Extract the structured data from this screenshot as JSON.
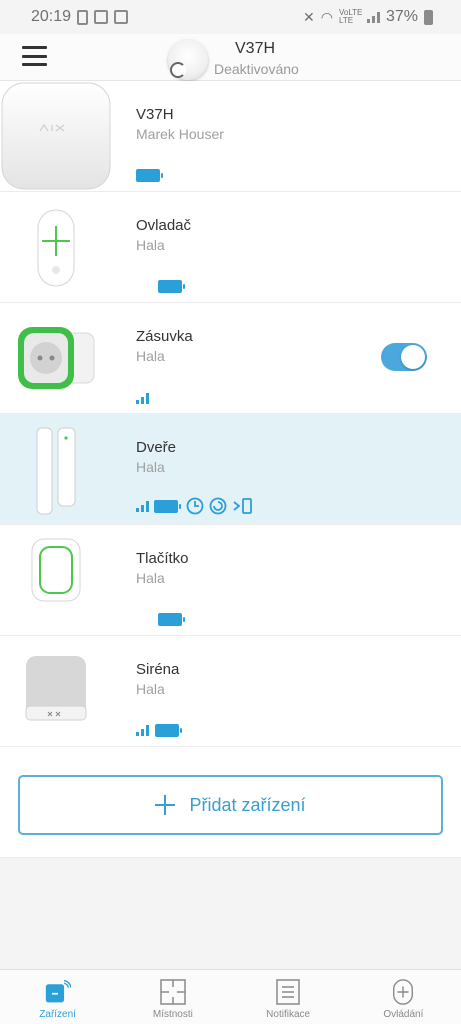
{
  "status_bar": {
    "time": "20:19",
    "network": "VoLTE LTE",
    "battery": "37%"
  },
  "header": {
    "hub_name": "V37H",
    "hub_status": "Deaktivováno"
  },
  "devices": [
    {
      "name": "V37H",
      "room": "Marek Houser"
    },
    {
      "name": "Ovladač",
      "room": "Hala"
    },
    {
      "name": "Zásuvka",
      "room": "Hala",
      "toggle_on": true
    },
    {
      "name": "Dveře",
      "room": "Hala",
      "selected": true
    },
    {
      "name": "Tlačítko",
      "room": "Hala"
    },
    {
      "name": "Siréna",
      "room": "Hala"
    }
  ],
  "add_device": {
    "label": "Přidat zařízení"
  },
  "bottom_nav": [
    {
      "label": "Zařízení",
      "active": true
    },
    {
      "label": "Místnosti"
    },
    {
      "label": "Notifikace"
    },
    {
      "label": "Ovládání"
    }
  ],
  "colors": {
    "accent": "#2b9fd8",
    "selected_row": "#e3f2f7",
    "toggle": "#4aa8dc"
  }
}
